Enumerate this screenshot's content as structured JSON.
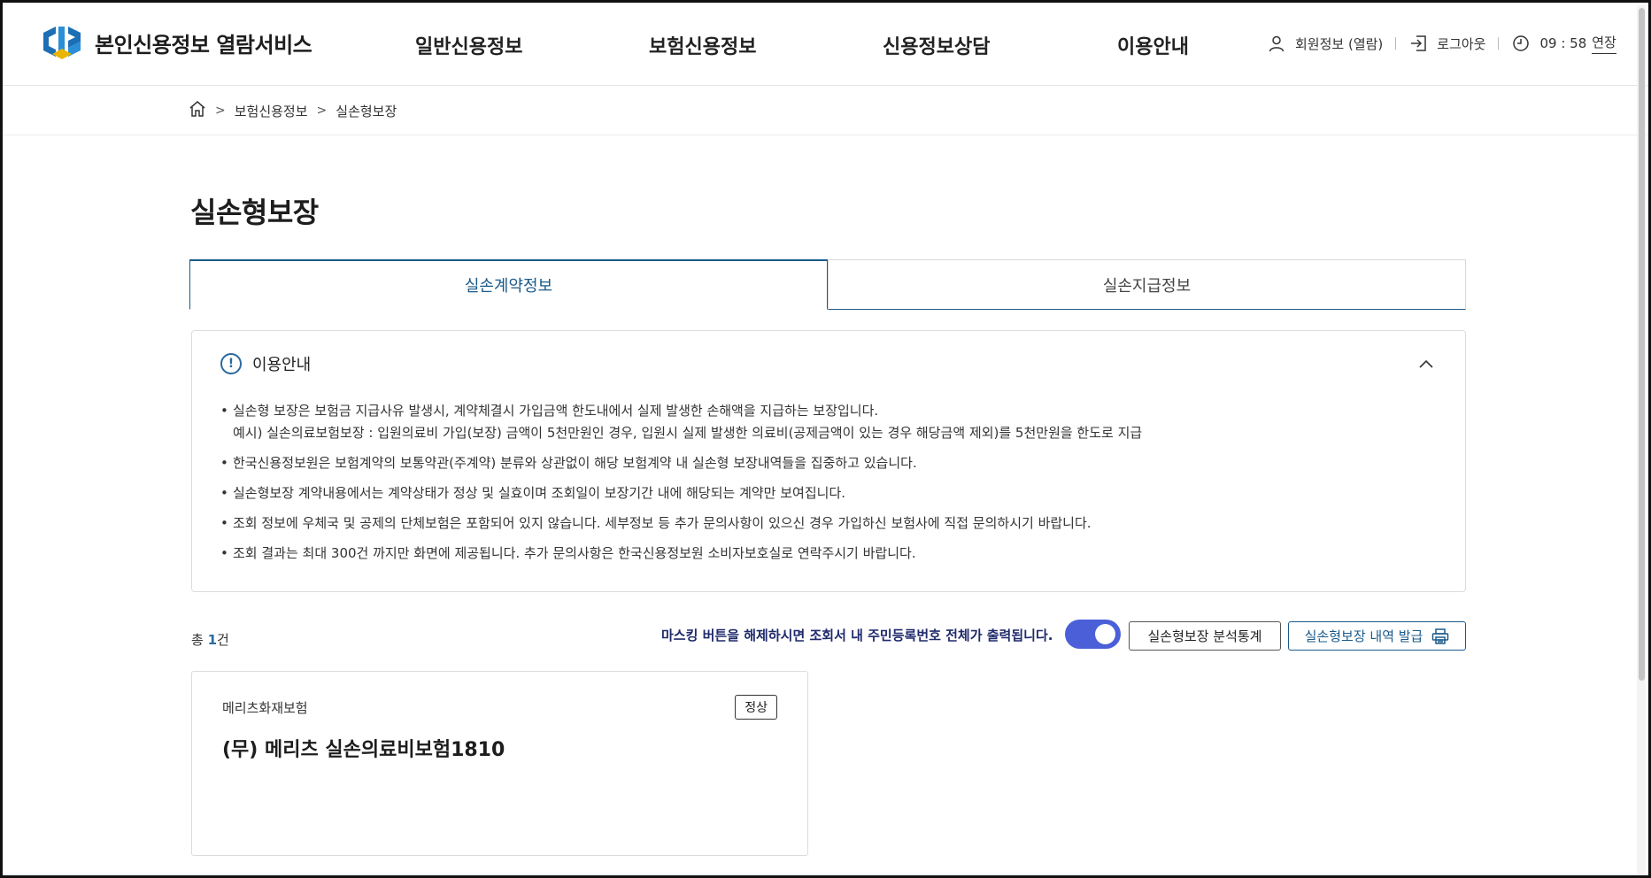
{
  "header": {
    "logo_text": "본인신용정보 열람서비스",
    "nav": [
      "일반신용정보",
      "보험신용정보",
      "신용정보상담",
      "이용안내"
    ],
    "member_info": "회원정보 (열람)",
    "logout": "로그아웃",
    "timer": "09 : 58",
    "extend": "연장"
  },
  "breadcrumb": {
    "level1": "보험신용정보",
    "level2": "실손형보장"
  },
  "page_title": "실손형보장",
  "tabs": [
    "실손계약정보",
    "실손지급정보"
  ],
  "info": {
    "title": "이용안내",
    "items": [
      "실손형 보장은 보험금 지급사유 발생시, 계약체결시 가입금액 한도내에서 실제 발생한 손해액을 지급하는 보장입니다.",
      "예시) 실손의료보험보장 : 입원의료비 가입(보장) 금액이 5천만원인 경우, 입원시 실제 발생한 의료비(공제금액이 있는 경우 해당금액 제외)를 5천만원을 한도로 지급",
      "한국신용정보원은 보험계약의 보통약관(주계약) 분류와 상관없이 해당 보험계약 내 실손형 보장내역들을 집중하고 있습니다.",
      "실손형보장 계약내용에서는 계약상태가 정상 및 실효이며 조회일이 보장기간 내에 해당되는 계약만 보여집니다.",
      "조회 정보에 우체국 및 공제의 단체보험은 포함되어 있지 않습니다. 세부정보 등 추가 문의사항이 있으신 경우 가입하신 보험사에 직접 문의하시기 바랍니다.",
      "조회 결과는 최대 300건 까지만 화면에 제공됩니다. 추가 문의사항은 한국신용정보원 소비자보호실로 연락주시기 바랍니다."
    ]
  },
  "result": {
    "total_prefix": "총 ",
    "total_count": "1",
    "total_suffix": "건",
    "mask_notice": "마스킹 버튼을 해제하시면 조회서 내 주민등록번호 전체가 출력됩니다.",
    "mask_on": true,
    "stat_button": "실손형보장 분석통계",
    "issue_button": "실손형보장 내역 발급"
  },
  "cards": [
    {
      "insurer": "메리츠화재보험",
      "status": "정상",
      "product": "(무) 메리츠 실손의료비보험1810"
    }
  ],
  "colors": {
    "accent": "#1a5a8a",
    "toggle": "#4a5fd8",
    "notice": "#1f2a6b"
  }
}
